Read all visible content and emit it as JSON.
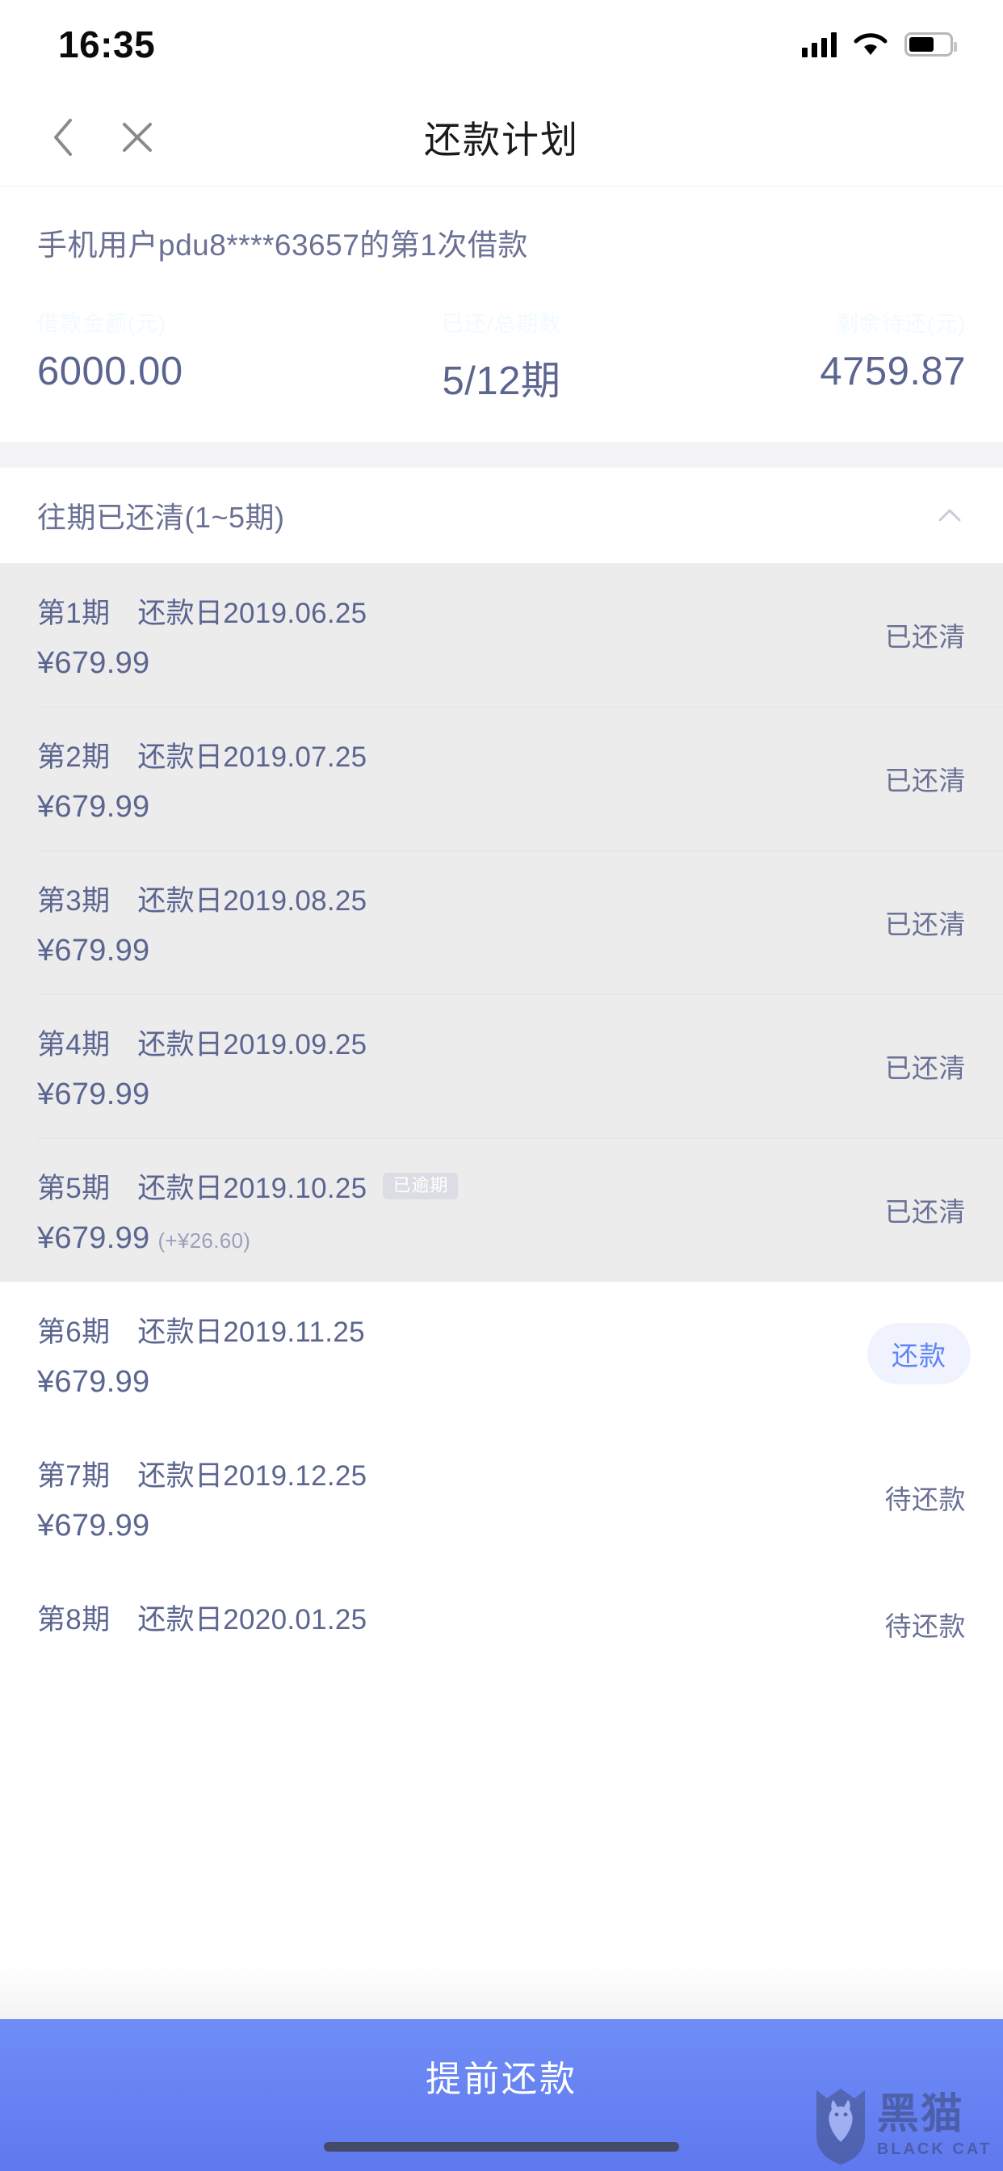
{
  "status_bar": {
    "time": "16:35",
    "signal_icon": "cellular-signal-icon",
    "wifi_icon": "wifi-icon",
    "battery_icon": "battery-icon"
  },
  "nav": {
    "back_icon": "chevron-left-icon",
    "close_icon": "close-icon",
    "title": "还款计划"
  },
  "summary": {
    "loan_title": "手机用户pdu8****63657的第1次借款",
    "stats": [
      {
        "label": "借款金额(元)",
        "value": "6000.00"
      },
      {
        "label": "已还/总期数",
        "value": "5/12期"
      },
      {
        "label": "剩余待还(元)",
        "value": "4759.87"
      }
    ]
  },
  "section": {
    "title": "往期已还清(1~5期)",
    "collapse_icon": "chevron-up-icon"
  },
  "rows": [
    {
      "period": "第1期",
      "date": "还款日2019.06.25",
      "amount": "¥679.99",
      "extra": "",
      "badge": "",
      "status": "已还清",
      "action": "",
      "state": "paid"
    },
    {
      "period": "第2期",
      "date": "还款日2019.07.25",
      "amount": "¥679.99",
      "extra": "",
      "badge": "",
      "status": "已还清",
      "action": "",
      "state": "paid"
    },
    {
      "period": "第3期",
      "date": "还款日2019.08.25",
      "amount": "¥679.99",
      "extra": "",
      "badge": "",
      "status": "已还清",
      "action": "",
      "state": "paid"
    },
    {
      "period": "第4期",
      "date": "还款日2019.09.25",
      "amount": "¥679.99",
      "extra": "",
      "badge": "",
      "status": "已还清",
      "action": "",
      "state": "paid"
    },
    {
      "period": "第5期",
      "date": "还款日2019.10.25",
      "amount": "¥679.99",
      "extra": "(+¥26.60)",
      "badge": "已逾期",
      "status": "已还清",
      "action": "",
      "state": "paid"
    },
    {
      "period": "第6期",
      "date": "还款日2019.11.25",
      "amount": "¥679.99",
      "extra": "",
      "badge": "",
      "status": "",
      "action": "还款",
      "state": "pending"
    },
    {
      "period": "第7期",
      "date": "还款日2019.12.25",
      "amount": "¥679.99",
      "extra": "",
      "badge": "",
      "status": "待还款",
      "action": "",
      "state": "pending"
    },
    {
      "period": "第8期",
      "date": "还款日2020.01.25",
      "amount": "",
      "extra": "",
      "badge": "",
      "status": "待还款",
      "action": "",
      "state": "pending"
    }
  ],
  "bottom": {
    "primary_label": "提前还款"
  },
  "watermark": {
    "cn": "黑猫",
    "en": "BLACK CAT",
    "icon": "cat-shield-logo-icon"
  },
  "colors": {
    "accent_blue": "#5f84f5",
    "bottom_bar": "#6f8df6",
    "text_primary": "#5b6590",
    "text_secondary": "#6b7194",
    "paid_row_bg": "#ececed"
  }
}
